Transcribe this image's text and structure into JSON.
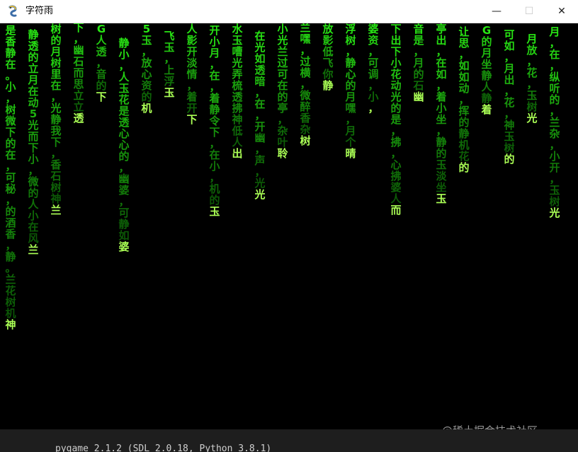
{
  "window": {
    "title": "字符雨",
    "minimize_label": "—",
    "maximize_label": "☐",
    "close_label": "✕"
  },
  "rain_columns": [
    {
      "text": "是香静在。小，树微下的在，可秘，的酒香，静。兰花树机神"
    },
    {
      "text": "静透的立月在动5光而下小，微的人小在风兰"
    },
    {
      "text": "树的月树里在，光静我下，香石树神兰"
    },
    {
      "text": "下，幽石而思立立透"
    },
    {
      "text": "G人透，音的下"
    },
    {
      "text": "静小，人玉花是透心心的，幽婆，可静如婆"
    },
    {
      "text": "5玉，放心资的机"
    },
    {
      "text": "飞玉，上浮玉"
    },
    {
      "text": "人影开淡情，着开下"
    },
    {
      "text": "开小月，在，着静令下，在小，机的玉"
    },
    {
      "text": "水玉嘈光弄梳透拂神低人出"
    },
    {
      "text": "在光如透暗，在，开幽，声，光光"
    },
    {
      "text": "小光兰过可在的亭，杂叶聆"
    },
    {
      "text": "兰嘿，过横，微醉香杂树"
    },
    {
      "text": "放影低飞你静"
    },
    {
      "text": "浮树，静心的月嘿，月个晴"
    },
    {
      "text": "婆资，可调，小，"
    },
    {
      "text": "下出下小花动光的是，拂，心拂婆人而"
    },
    {
      "text": "音是，月的石幽"
    },
    {
      "text": "亭出，在如，着小坐，静的玉淡坐玉"
    },
    {
      "text": "让思，如如动，挥的静机花的"
    },
    {
      "text": "G的月坐静人静着"
    },
    {
      "text": "可如，月出，花，神玉树的"
    },
    {
      "text": "月放，花，玉树光"
    },
    {
      "text": "月，在，纵听的，兰杂，小开，玉树光"
    }
  ],
  "watermark": "@稀土掘金技术社区",
  "status_bar": {
    "text": "pygame 2.1.2 (SDL 2.0.18, Python 3.8.1)"
  }
}
